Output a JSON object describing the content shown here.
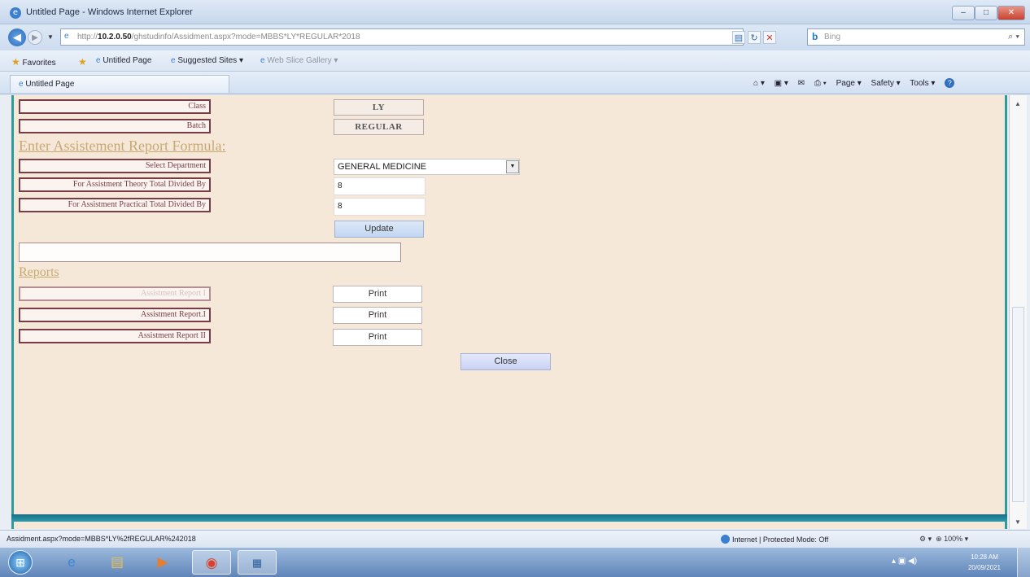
{
  "window": {
    "title": "Untitled Page - Windows Internet Explorer",
    "controls": {
      "minimize": "–",
      "maximize": "□",
      "close": "✕"
    }
  },
  "address": {
    "url_prefix": "http://",
    "url_host": "10.2.0.50",
    "url_rest": "/ghstudinfo/Assidment.aspx?mode=MBBS*LY*REGULAR*2018",
    "search_placeholder": "Bing",
    "search_engine": "b"
  },
  "favorites_bar": {
    "favorites_label": "Favorites",
    "untitled_page": "Untitled Page",
    "suggested_sites": "Suggested Sites ▾",
    "web_slice_gallery": "Web Slice Gallery ▾"
  },
  "tab": {
    "label": "Untitled Page"
  },
  "command_bar": {
    "page": "Page ▾",
    "safety": "Safety ▾",
    "tools": "Tools ▾"
  },
  "form": {
    "class_label": "Class",
    "class_value": "LY",
    "batch_label": "Batch",
    "batch_value": "REGULAR",
    "formula_heading": "Enter Assistement Report Formula:",
    "select_department_label": "Select Department",
    "department_value": "GENERAL MEDICINE",
    "theory_label": "For Assistment Theory Total Divided By",
    "theory_value": "8",
    "practical_label": "For Assistment Practical Total Divided By",
    "practical_value": "8",
    "update_button": "Update",
    "reports_heading": "Reports",
    "report1_label": "Assistment Report I",
    "report2_label": "Assistment Report.I",
    "report3_label": "Assistment Report II",
    "print_label": "Print",
    "close_button": "Close"
  },
  "status": {
    "url": "Assidment.aspx?mode=MBBS*LY%2fREGULAR%242018",
    "zone": "Internet | Protected Mode: Off",
    "zoom": "100%"
  },
  "taskbar": {
    "clock_time": "10:28 AM",
    "clock_date": "20/09/2021"
  }
}
